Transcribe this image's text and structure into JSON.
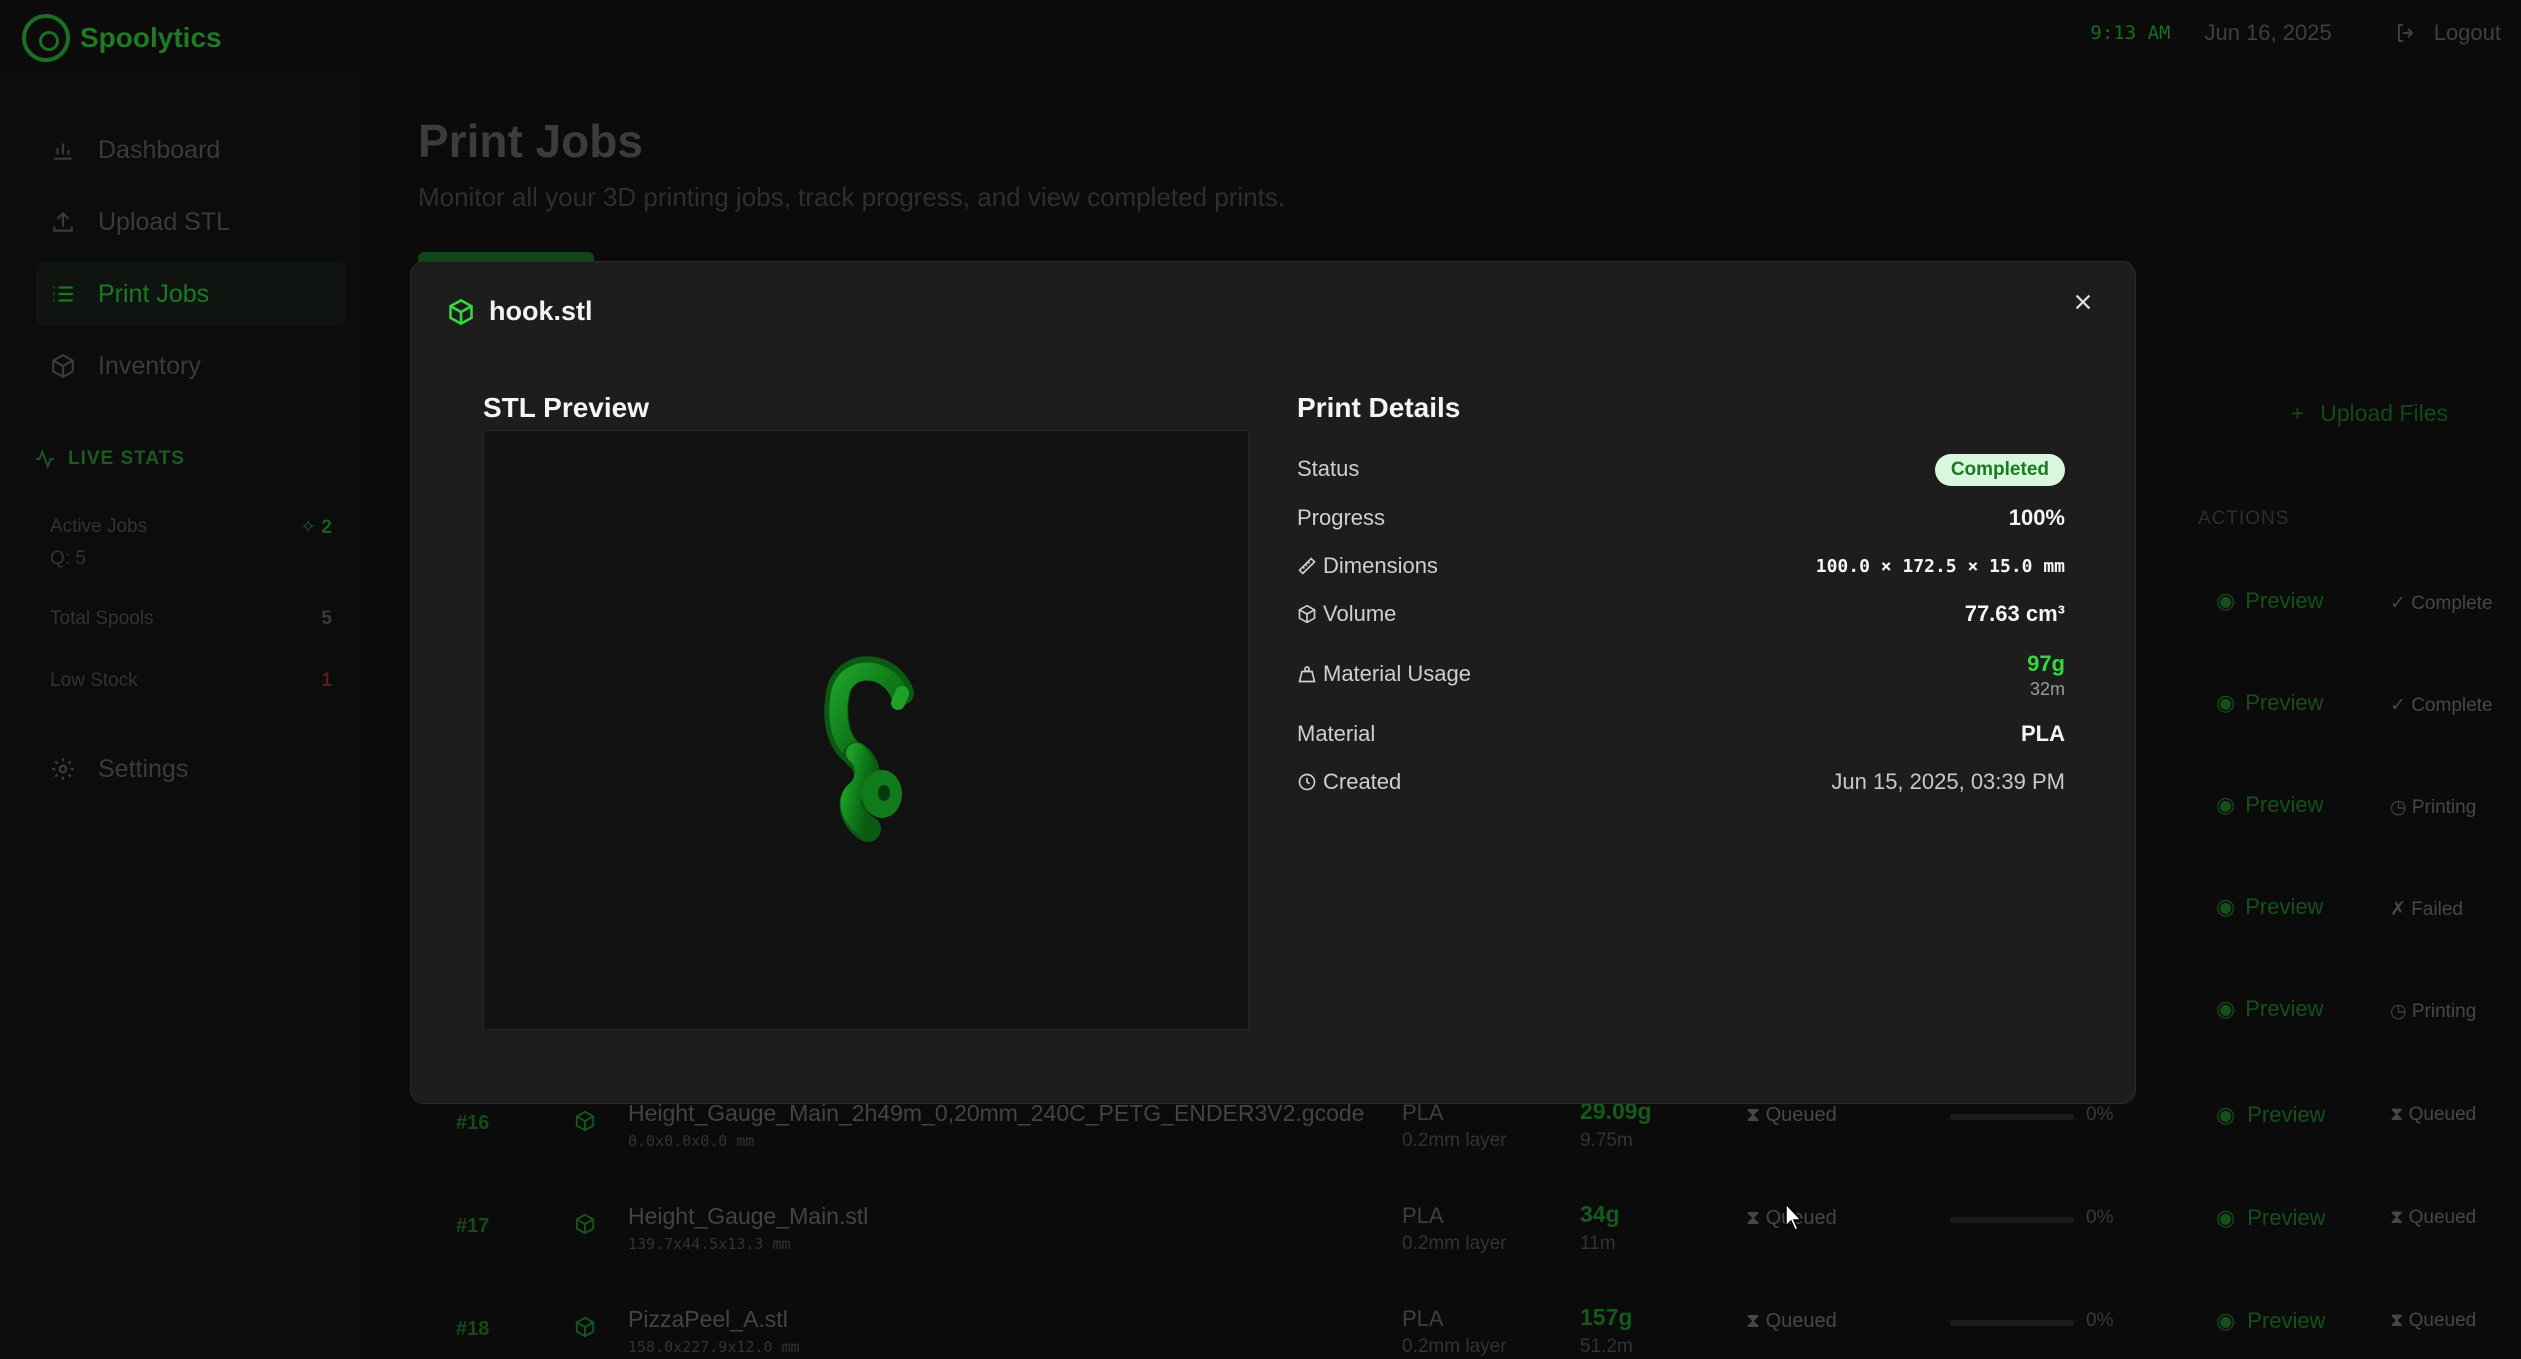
{
  "app": {
    "name": "Spoolytics",
    "time": "9:13 AM",
    "date": "Jun 16, 2025",
    "logout": "Logout",
    "accent": "#33d93d"
  },
  "sidebar": {
    "items": [
      {
        "label": "Dashboard",
        "icon": "bar-chart-icon"
      },
      {
        "label": "Upload STL",
        "icon": "upload-icon"
      },
      {
        "label": "Print Jobs",
        "icon": "list-icon"
      },
      {
        "label": "Inventory",
        "icon": "cube-icon"
      }
    ],
    "live_stats_title": "LIVE STATS",
    "stats": {
      "active_jobs_label": "Active Jobs",
      "active_jobs_value": "2",
      "queue_label": "Q: 5",
      "total_spools_label": "Total Spools",
      "total_spools_value": "5",
      "low_stock_label": "Low Stock",
      "low_stock_value": "1"
    },
    "settings_label": "Settings"
  },
  "main": {
    "title": "Print Jobs",
    "subtitle": "Monitor all your 3D printing jobs, track progress, and view completed prints.",
    "upload_files": "Upload Files",
    "actions_header": "ACTIONS",
    "preview_label": "Preview",
    "background_statuses": [
      "✓ Complete",
      "✓ Complete",
      "◷ Printing",
      "✗ Failed",
      "◷ Printing"
    ],
    "jobs": [
      {
        "id": "#16",
        "name": "Height_Gauge_Main_2h49m_0,20mm_240C_PETG_ENDER3V2.gcode",
        "dims": "0.0x0.0x0.0 mm",
        "material": "PLA",
        "layer": "0.2mm layer",
        "weight": "29.09g",
        "time": "9.75m",
        "status": "⧗ Queued",
        "progress": "0%",
        "action_status": "⧗ Queued"
      },
      {
        "id": "#17",
        "name": "Height_Gauge_Main.stl",
        "dims": "139.7x44.5x13.3 mm",
        "material": "PLA",
        "layer": "0.2mm layer",
        "weight": "34g",
        "time": "11m",
        "status": "⧗ Queued",
        "progress": "0%",
        "action_status": "⧗ Queued"
      },
      {
        "id": "#18",
        "name": "PizzaPeel_A.stl",
        "dims": "158.0x227.9x12.0 mm",
        "material": "PLA",
        "layer": "0.2mm layer",
        "weight": "157g",
        "time": "51.2m",
        "status": "⧗ Queued",
        "progress": "0%",
        "action_status": "⧗ Queued"
      }
    ]
  },
  "modal": {
    "title": "hook.stl",
    "preview_title": "STL Preview",
    "details_title": "Print Details",
    "details": {
      "status_label": "Status",
      "status_value": "Completed",
      "progress_label": "Progress",
      "progress_value": "100%",
      "dimensions_label": "Dimensions",
      "dimensions_value": "100.0 × 172.5 × 15.0 mm",
      "volume_label": "Volume",
      "volume_value": "77.63 cm³",
      "material_usage_label": "Material Usage",
      "material_usage_weight": "97g",
      "material_usage_time": "32m",
      "material_label": "Material",
      "material_value": "PLA",
      "created_label": "Created",
      "created_value": "Jun 15, 2025, 03:39 PM"
    }
  }
}
